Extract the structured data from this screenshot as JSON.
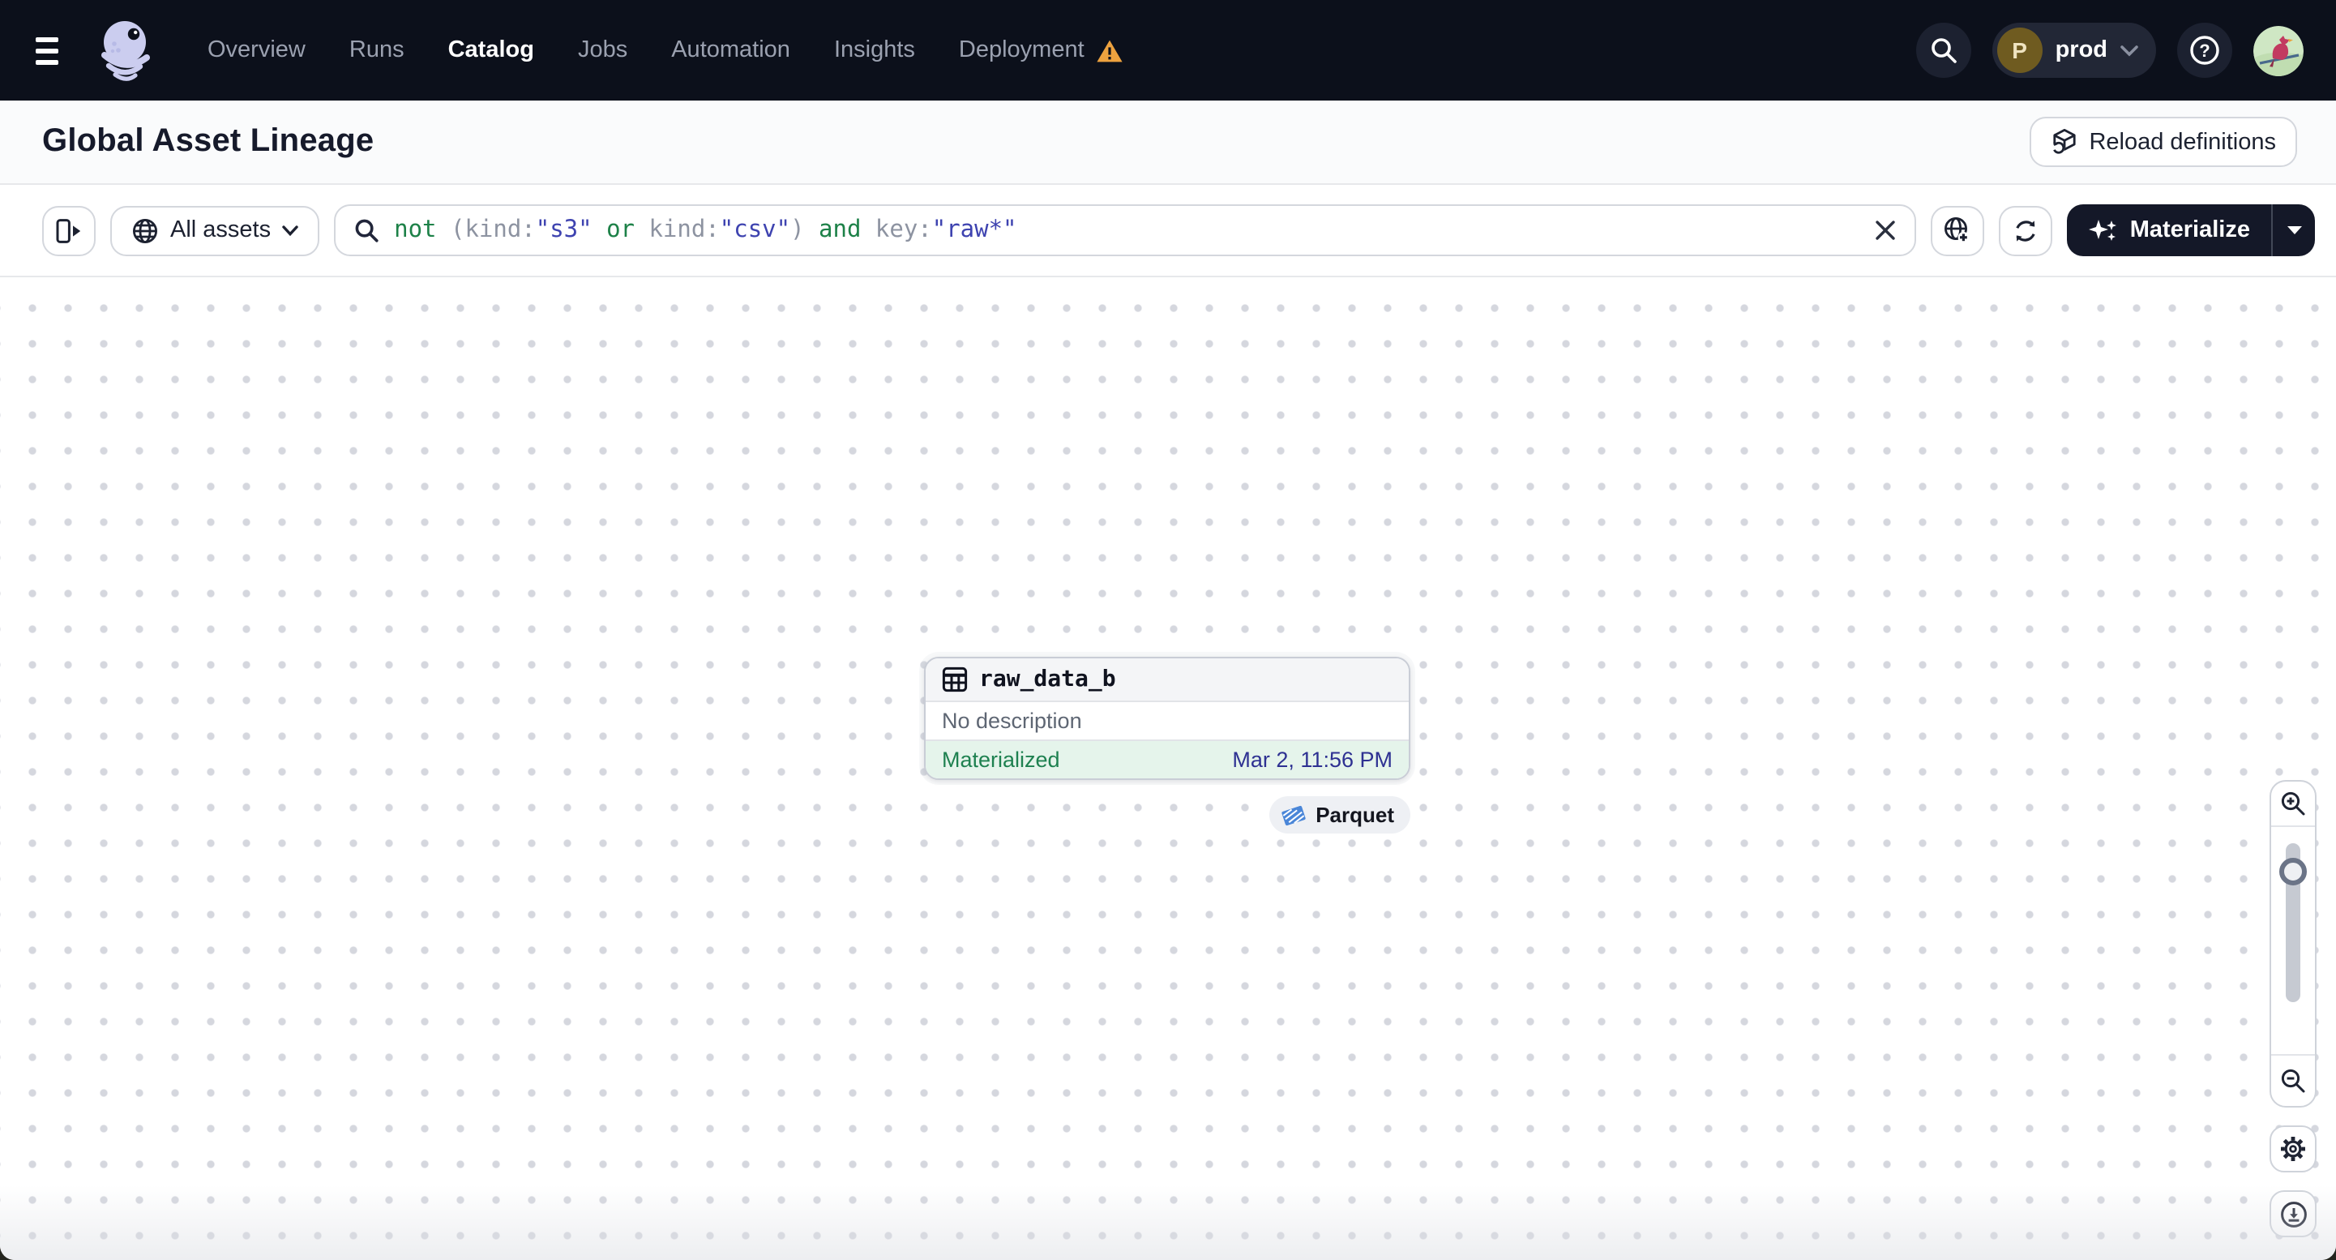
{
  "navbar": {
    "menu_items": [
      "Overview",
      "Runs",
      "Catalog",
      "Jobs",
      "Automation",
      "Insights",
      "Deployment"
    ],
    "active_item": "Catalog",
    "environment": {
      "initial": "P",
      "name": "prod"
    }
  },
  "page_header": {
    "title": "Global Asset Lineage",
    "reload_button_label": "Reload definitions"
  },
  "filter_bar": {
    "scope_button_label": "All assets",
    "query_segments": [
      {
        "text": "not",
        "type": "keyword"
      },
      {
        "text": " (kind:",
        "type": "plain"
      },
      {
        "text": "\"s3\"",
        "type": "value"
      },
      {
        "text": " ",
        "type": "plain"
      },
      {
        "text": "or",
        "type": "keyword"
      },
      {
        "text": " kind:",
        "type": "plain"
      },
      {
        "text": "\"csv\"",
        "type": "value"
      },
      {
        "text": ") ",
        "type": "plain"
      },
      {
        "text": "and",
        "type": "keyword"
      },
      {
        "text": " key:",
        "type": "plain"
      },
      {
        "text": "\"raw*\"",
        "type": "value"
      }
    ],
    "materialize_button_label": "Materialize"
  },
  "canvas": {
    "asset_node": {
      "name": "raw_data_b",
      "description": "No description",
      "status": "Materialized",
      "materialized_at": "Mar 2, 11:56 PM"
    },
    "kind_tag": "Parquet"
  },
  "colors": {
    "nav_bg": "#0c101b",
    "query_keyword_green": "#1d8148",
    "query_value_indigo": "#3e43b0",
    "status_green": "#1e8150",
    "status_bg_green": "#e5f4eb",
    "timestamp_indigo": "#2e3192",
    "warning_orange": "#eda23f",
    "parquet_blue": "#4a86d8"
  }
}
